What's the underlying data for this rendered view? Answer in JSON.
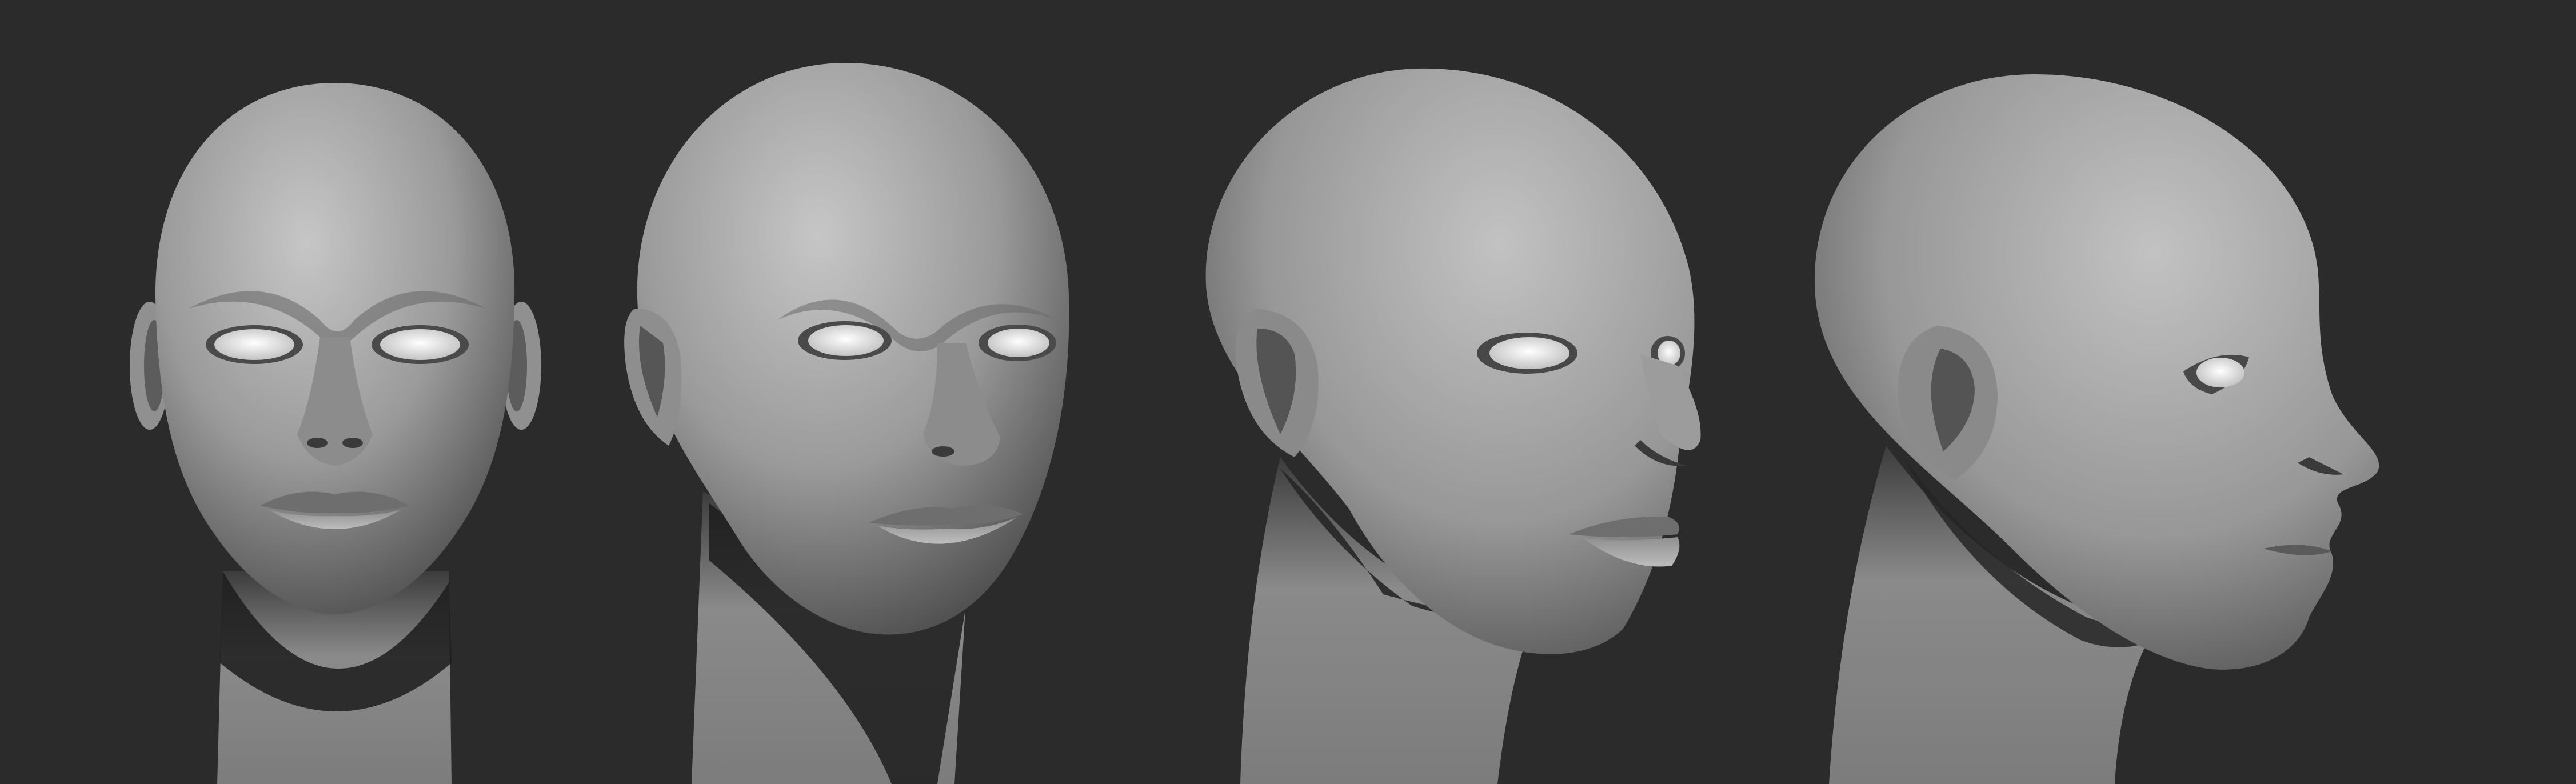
{
  "scene": {
    "description_kind": "sculpt-turnaround",
    "background_color": "#2b2b2b",
    "clay_color": "#9a9a9a",
    "eye_color": "#e6e6e6",
    "views": [
      {
        "icon": "head-front-view"
      },
      {
        "icon": "head-three-quarter-view-1"
      },
      {
        "icon": "head-three-quarter-view-2"
      },
      {
        "icon": "head-profile-view"
      }
    ]
  }
}
